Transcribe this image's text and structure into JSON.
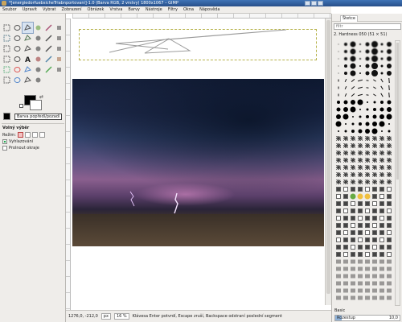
{
  "window": {
    "title": "*[energiedorfuebsicheTriabnportovani]-1.0 (Barva RGB, 2 vrstvy) 1800x1067 – GIMP"
  },
  "menubar": {
    "items": [
      "Soubor",
      "Upravit",
      "Vybrat",
      "Zobrazení",
      "Obrázek",
      "Vrstva",
      "Barvy",
      "Nástroje",
      "Filtry",
      "Okna",
      "Nápověda"
    ]
  },
  "toolbox": {
    "tools": [
      {
        "name": "rect-select-icon"
      },
      {
        "name": "ellipse-select-icon"
      },
      {
        "name": "free-select-icon"
      },
      {
        "name": "fuzzy-select-icon"
      },
      {
        "name": "color-select-icon"
      },
      {
        "name": "scissors-icon"
      },
      {
        "name": "foreground-select-icon"
      },
      {
        "name": "paths-icon"
      },
      {
        "name": "color-picker-icon"
      },
      {
        "name": "zoom-icon"
      },
      {
        "name": "measure-icon"
      },
      {
        "name": "move-icon"
      },
      {
        "name": "align-icon"
      },
      {
        "name": "crop-icon"
      },
      {
        "name": "rotate-icon"
      },
      {
        "name": "scale-icon"
      },
      {
        "name": "shear-icon"
      },
      {
        "name": "perspective-icon"
      },
      {
        "name": "flip-icon"
      },
      {
        "name": "cage-icon"
      },
      {
        "name": "text-icon"
      },
      {
        "name": "bucket-fill-icon"
      },
      {
        "name": "blend-icon"
      },
      {
        "name": "pencil-icon"
      },
      {
        "name": "paintbrush-icon"
      },
      {
        "name": "eraser-icon"
      },
      {
        "name": "airbrush-icon"
      },
      {
        "name": "ink-icon"
      },
      {
        "name": "clone-icon"
      },
      {
        "name": "heal-icon"
      },
      {
        "name": "perspective-clone-icon"
      },
      {
        "name": "blur-icon"
      },
      {
        "name": "smudge-icon"
      },
      {
        "name": "dodge-burn-icon"
      }
    ],
    "tooltip": "Barva popředí/pozadí",
    "tool_options": {
      "title": "Volný výběr",
      "mode_label": "Režim:",
      "antialias_label": "Vyhlazování",
      "feather_label": "Prolnout okraje"
    }
  },
  "canvas": {
    "path_color": "#9a9a9a",
    "selection_color": "#b6b24a"
  },
  "statusbar": {
    "coords": "1276,0, -212,0",
    "unit": "px",
    "zoom": "16 %",
    "message": "Klávesa Enter potvrdí, Escape zruší, Backspace odstraní poslední segment"
  },
  "dock": {
    "tab_label": "Štetce",
    "filter_placeholder": "filtr",
    "current_brush": "2. Hardness 050 (51 × 51)",
    "preset_label": "Basic",
    "spacing_label": "Rozestup",
    "spacing_value": "10,0",
    "spacing_fraction": 0.1
  }
}
